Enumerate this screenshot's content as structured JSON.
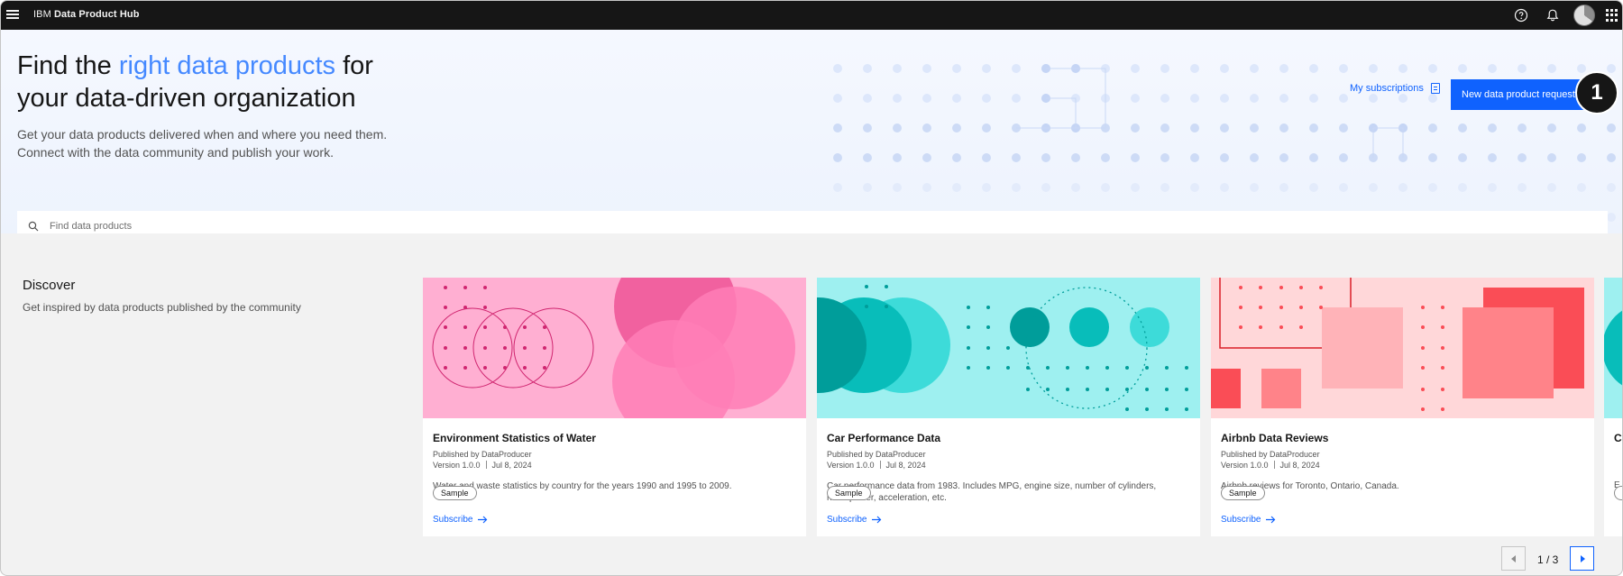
{
  "header": {
    "brand_prefix": "IBM",
    "brand_name": "Data Product Hub",
    "menu_icon": "menu-icon",
    "help_icon": "help-icon",
    "notification_icon": "bell-icon",
    "apps_icon": "app-switcher-icon"
  },
  "hero": {
    "title_start": "Find the ",
    "title_accent": "right data products",
    "title_mid": " for",
    "title_line2": "your data-driven organization",
    "subtitle_line1": "Get your data products delivered when and where you need them.",
    "subtitle_line2": "Connect with the data community and publish your work.",
    "my_subscriptions": "My subscriptions",
    "new_request": "New data product request",
    "step_badge": "1",
    "search_placeholder": "Find data products"
  },
  "discover": {
    "title": "Discover",
    "subtitle": "Get inspired by data products published by the community"
  },
  "cards": [
    {
      "title": "Environment Statistics of Water",
      "publisher": "Published by DataProducer",
      "version": "Version 1.0.0",
      "date": "Jul 8, 2024",
      "description": "Water and waste statistics by country for the years 1990 and 1995 to 2009.",
      "tag": "Sample",
      "subscribe": "Subscribe"
    },
    {
      "title": "Car Performance Data",
      "publisher": "Published by DataProducer",
      "version": "Version 1.0.0",
      "date": "Jul 8, 2024",
      "description": "Car performance data from 1983. Includes MPG, engine size, number of cylinders, horsepower, acceleration, etc.",
      "tag": "Sample",
      "subscribe": "Subscribe"
    },
    {
      "title": "Airbnb Data Reviews",
      "publisher": "Published by DataProducer",
      "version": "Version 1.0.0",
      "date": "Jul 8, 2024",
      "description": "Airbnb reviews for Toronto, Ontario, Canada.",
      "tag": "Sample",
      "subscribe": "Subscribe"
    },
    {
      "title": "Cu",
      "description": "E",
      "tag": "S"
    }
  ],
  "pagination": {
    "text": "1 / 3",
    "prev_icon": "chevron-left-icon",
    "next_icon": "chevron-right-icon"
  },
  "colors": {
    "topbar": "#161616",
    "primary": "#0f62fe",
    "accent_text": "#4589ff",
    "card1_bg": "#ffafd2",
    "card2_bg": "#9ef0f0",
    "card3_bg": "#ffd7d9"
  }
}
